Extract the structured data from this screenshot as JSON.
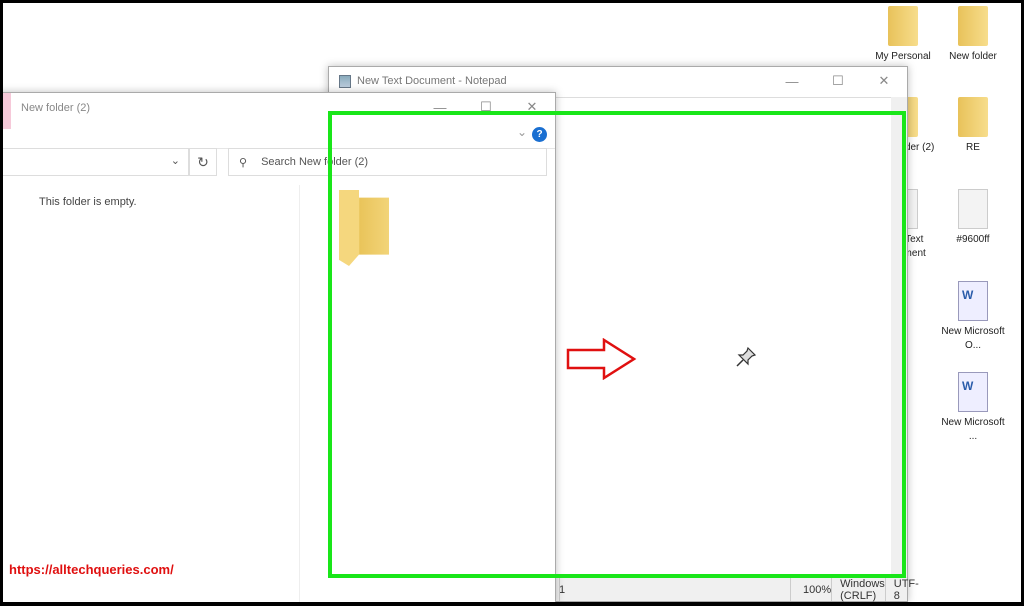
{
  "desktop": {
    "icons": [
      {
        "label": "My Personal",
        "type": "folder"
      },
      {
        "label": "New folder",
        "type": "folder"
      },
      {
        "label": "New folder (2)",
        "type": "folder"
      },
      {
        "label": "RE",
        "type": "folder"
      },
      {
        "label": "New Text Document",
        "type": "text"
      },
      {
        "label": "#9600ff",
        "type": "text"
      },
      {
        "label": "New Microsoft O...",
        "type": "word"
      },
      {
        "label": "New Microsoft ...",
        "type": "word"
      }
    ]
  },
  "notepad": {
    "title": "New Text Document - Notepad",
    "status": {
      "position": "1",
      "zoom": "100%",
      "line_ending": "Windows (CRLF)",
      "encoding": "UTF-8"
    }
  },
  "explorer": {
    "title": "New folder (2)",
    "search_placeholder": "Search New folder (2)",
    "empty_message": "This folder is empty.",
    "help": "?"
  },
  "controls": {
    "minimize": "—",
    "maximize": "☐",
    "close": "✕"
  },
  "watermark": "https://alltechqueries.com/",
  "colors": {
    "highlight": "#19e619",
    "arrow": "#e01010"
  }
}
